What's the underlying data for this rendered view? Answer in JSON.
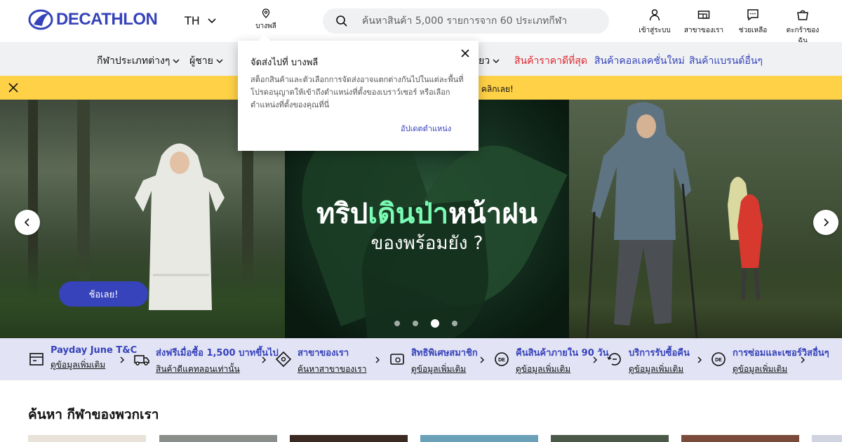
{
  "header": {
    "logo_text": "DECATHLON",
    "lang": "TH",
    "location": "บางพลี",
    "search_placeholder": "ค้นหาสินค้า 5,000 รายการจาก 60 ประเภทกีฬา",
    "icons": [
      {
        "label": "เข้าสู่ระบบ",
        "icon": "user-icon"
      },
      {
        "label": "สาขาของเรา",
        "icon": "store-icon"
      },
      {
        "label": "ช่วยเหลือ",
        "icon": "chat-icon"
      },
      {
        "label": "ตะกร้าของฉัน",
        "icon": "basket-icon"
      }
    ]
  },
  "nav": {
    "items": [
      {
        "label": "กีฬาประเภทต่างๆ"
      },
      {
        "label": "ผู้ชาย"
      },
      {
        "label": "ยว"
      },
      {
        "label": "สินค้าราคาดีที่สุด"
      },
      {
        "label": "สินค้าคอลเลคชั่นใหม่"
      },
      {
        "label": "สินค้าแบรนด์อื่นๆ"
      }
    ]
  },
  "banner": {
    "text": "– คลิกเลย!"
  },
  "popup": {
    "title": "จัดส่งไปที่ บางพลี",
    "body": "สต็อกสินค้าและตัวเลือกการจัดส่งอาจแตกต่างกันไปในแต่ละพื้นที่ โปรดอนุญาตให้เข้าถึงตำแหน่งที่ตั้งของเบราว์เซอร์ หรือเลือกตำแหน่งที่ตั้งของคุณที่นี่",
    "link": "อัปเดตตำแหน่ง"
  },
  "hero": {
    "title_a": "ทริป",
    "title_b": "เดินป่า",
    "title_c": "หน้าฝน",
    "subtitle": "ของพร้อมยัง ?",
    "cta": "ช้อเลย!",
    "slide_count": 4,
    "active_slide": 3
  },
  "services": [
    {
      "title": "Payday June T&C",
      "link": "ดูข้อมูลเพิ่มเติม",
      "icon": "receipt-icon"
    },
    {
      "title": "ส่งฟรีเมื่อซื้อ 1,500 บาทขึ้นไป",
      "link": "สินค้าดีแคทลอนเท่านั้น",
      "icon": "truck-icon"
    },
    {
      "title": "สาขาของเรา",
      "link": "ค้นหาสาขาของเรา",
      "icon": "location-diamond-icon"
    },
    {
      "title": "สิทธิพิเศษสมาชิก",
      "link": "ดูข้อมูลเพิ่มเติม",
      "icon": "member-card-icon"
    },
    {
      "title": "คืนสินค้าภายใน 90 วัน",
      "link": "ดูข้อมูลเพิ่มเติม",
      "icon": "return-icon"
    },
    {
      "title": "บริการรับซื้อคืน",
      "link": "ดูข้อมูลเพิ่มเติม",
      "icon": "buyback-icon"
    },
    {
      "title": "การซ่อมและเซอร์วิสอื่นๆ",
      "link": "ดูข้อมูลเพิ่มเติม",
      "icon": "repair-icon"
    }
  ],
  "sports_section": {
    "title": "ค้นหา กีฬาของพวกเรา"
  },
  "colors": {
    "brand": "#3643ba",
    "banner": "#ffd147",
    "accent_green": "#7afcb5",
    "sale_red": "#e3262f"
  }
}
